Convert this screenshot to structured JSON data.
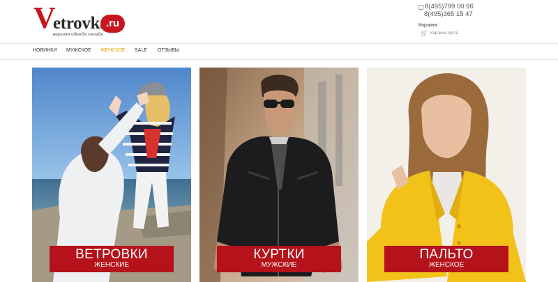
{
  "logo": {
    "initial": "V",
    "rest": "etrovka",
    "badge": ".ru",
    "tagline": "верхняя одежда онлайн"
  },
  "contacts": {
    "phone1": "8(495)799 00 96",
    "phone2": "8(495)365 15 47"
  },
  "cart": {
    "label": "Корзина",
    "status": "Корзина пуста"
  },
  "nav": {
    "items": [
      {
        "label": "НОВИНКИ"
      },
      {
        "label": "МУЖСКОЕ"
      },
      {
        "label": "ЖЕНСКОЕ",
        "active": true
      },
      {
        "label": "SALE"
      },
      {
        "label": "ОТЗЫВЫ"
      }
    ]
  },
  "banners": [
    {
      "title": "ВЕТРОВКИ",
      "subtitle": "ЖЕНСКИЕ"
    },
    {
      "title": "КУРТКИ",
      "subtitle": "МУЖСКИЕ"
    },
    {
      "title": "ПАЛЬТО",
      "subtitle": "ЖЕНСКОЕ"
    }
  ],
  "colors": {
    "brand": "#c8161e",
    "active_nav": "#e0a000",
    "label_bg": "#b5121b"
  }
}
